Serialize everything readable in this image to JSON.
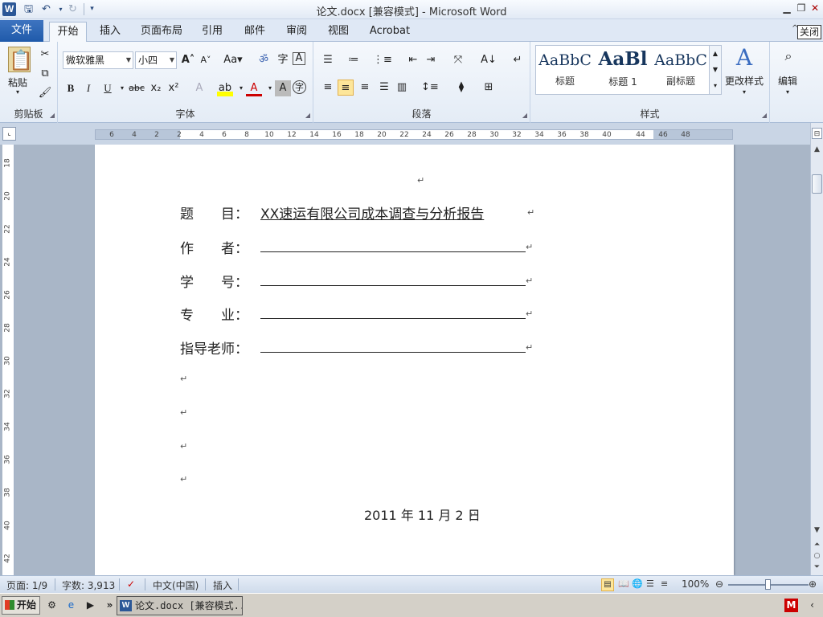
{
  "titlebar": {
    "logo": "W",
    "title": "论文.docx [兼容模式]  -  Microsoft Word",
    "quick_access": [
      "save-icon",
      "undo-icon",
      "redo-icon",
      "customize-icon"
    ]
  },
  "tabs": {
    "file": "文件",
    "items": [
      "开始",
      "插入",
      "页面布局",
      "引用",
      "邮件",
      "审阅",
      "视图",
      "Acrobat"
    ],
    "close_tooltip": "关闭"
  },
  "ribbon": {
    "clipboard": {
      "label": "剪贴板",
      "paste": "粘贴"
    },
    "font": {
      "label": "字体",
      "family": "微软雅黑",
      "size": "小四"
    },
    "paragraph": {
      "label": "段落"
    },
    "styles": {
      "label": "样式",
      "items": [
        {
          "preview": "AaBbC",
          "name": "标题"
        },
        {
          "preview": "AaBl",
          "name": "标题 1"
        },
        {
          "preview": "AaBbC",
          "name": "副标题"
        }
      ],
      "change": "更改样式"
    },
    "editing": {
      "label": "编辑"
    }
  },
  "ruler": {
    "h_ticks": [
      "6",
      "4",
      "2",
      "2",
      "4",
      "6",
      "8",
      "10",
      "12",
      "14",
      "16",
      "18",
      "20",
      "22",
      "24",
      "26",
      "28",
      "30",
      "32",
      "34",
      "36",
      "38",
      "40",
      "44",
      "46",
      "48"
    ],
    "v_ticks": [
      "18",
      "20",
      "22",
      "24",
      "26",
      "28",
      "30",
      "32",
      "34",
      "36",
      "38",
      "40",
      "42"
    ]
  },
  "document": {
    "fields": [
      {
        "label": "题　　目：",
        "value": "XX速运有限公司成本调查与分析报告"
      },
      {
        "label": "作　　者：",
        "value": ""
      },
      {
        "label": "学　　号：",
        "value": ""
      },
      {
        "label": "专　　业：",
        "value": ""
      },
      {
        "label": "指导老师：",
        "value": ""
      }
    ],
    "date": "2011 年 11 月 2 日",
    "paragraph_mark": "↵"
  },
  "statusbar": {
    "page": "页面: 1/9",
    "words": "字数: 3,913",
    "language": "中文(中国)",
    "mode": "插入",
    "zoom": "100%"
  },
  "taskbar": {
    "start": "开始",
    "task": "论文.docx [兼容模式..."
  }
}
